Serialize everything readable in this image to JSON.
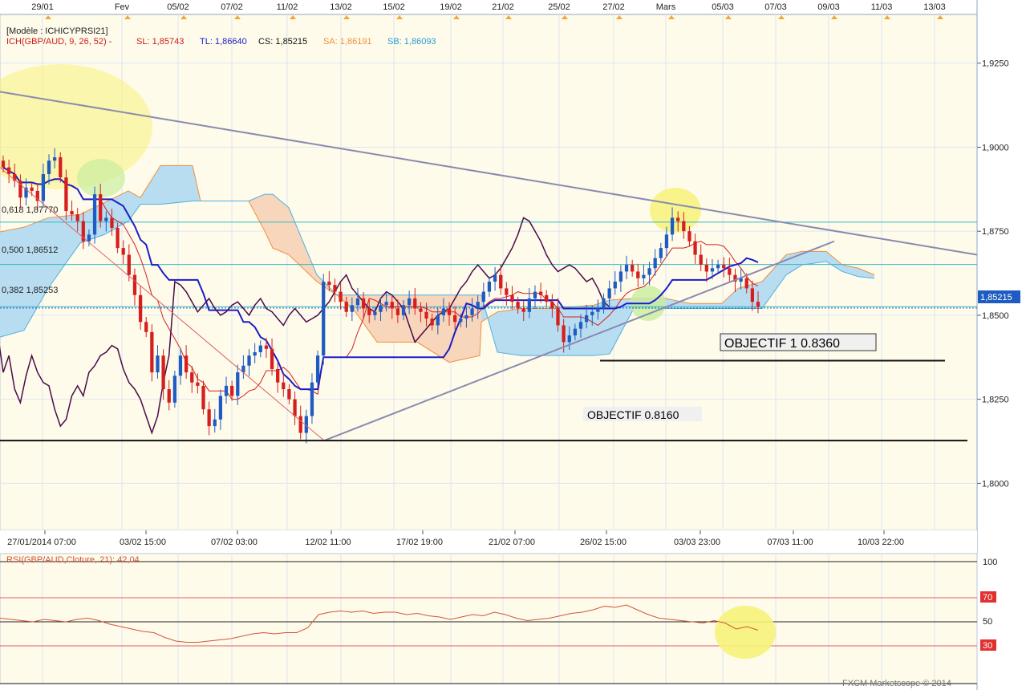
{
  "header": {
    "model": "[Modèle : ICHICYPRSI21]",
    "ichimoku_name": "ICH(GBP/AUD, 9, 26, 52) -",
    "sl": "SL: 1,85743",
    "tl": "TL: 1,86640",
    "cs": "CS: 1,85215",
    "sa": "SA: 1,86191",
    "sb": "SB: 1,86093"
  },
  "colors": {
    "background": "#FFFFFF",
    "price_panel": "#FEFBEA",
    "grid": "#DEE6F2",
    "top_axis": "#FFFFFF",
    "bull_candle": "#1F5CC2",
    "bear_candle": "#D71E1E",
    "tenkan": "#D71E1E",
    "kijun": "#1C1CC8",
    "chikou": "#4A0A4A",
    "senkou_a": "#F08E3C",
    "senkou_b": "#4EB0E0",
    "cloud_bull": "#B9DDF0",
    "cloud_bear": "#F7D6BB",
    "fib_line": "#39B7C4",
    "trendline": "#8A8AB0",
    "highlight_yellow": "#F7F27A",
    "highlight_green": "#C9EE9E",
    "current_price_tag": "#1F5CC2",
    "rsi_line": "#D2553A",
    "rsi_band": "#E06060",
    "rsi_tag": "#E03030"
  },
  "top_dates": [
    "29/01",
    "Fev",
    "05/02",
    "07/02",
    "11/02",
    "13/02",
    "15/02",
    "19/02",
    "21/02",
    "25/02",
    "27/02",
    "Mars",
    "05/03",
    "07/03",
    "09/03",
    "11/03",
    "13/03"
  ],
  "bottom_dates": [
    "27/01/2014 07:00",
    "03/02 15:00",
    "07/02 03:00",
    "12/02 11:00",
    "17/02 19:00",
    "21/02 07:00",
    "26/02 15:00",
    "03/03 23:00",
    "07/03 11:00",
    "10/03 22:00"
  ],
  "fib_labels": [
    "0,618 1,87770",
    "0,500 1,86512",
    "0,382 1,85253"
  ],
  "annotations": {
    "objectif1": "OBJECTIF 1 0.8360",
    "objectif2": "OBJECTIF 0.8160"
  },
  "current_price": "1,85215",
  "rsi": {
    "label": "RSI(GBP/AUD,Cloture, 21): 42,04",
    "levels": [
      "100",
      "70",
      "50",
      "30"
    ]
  },
  "footer": "FXCM Marketscope © 2014",
  "chart_data": {
    "type": "candlestick",
    "title": "",
    "instrument": "GBP/AUD",
    "y_axis": {
      "ticks": [
        "1,9250",
        "1,9000",
        "1,8750",
        "1,8500",
        "1,8250",
        "1,8000"
      ],
      "range": [
        1.786,
        1.9395
      ]
    },
    "fib_levels": [
      {
        "ratio": "0,618",
        "value": 1.8777
      },
      {
        "ratio": "0,500",
        "value": 1.86512
      },
      {
        "ratio": "0,382",
        "value": 1.85253
      }
    ],
    "horizontal_lines": [
      {
        "name": "OBJECTIF 1 0.8360",
        "value": 1.8365
      },
      {
        "name": "OBJECTIF 0.8160",
        "value": 1.8127
      }
    ],
    "ichimoku": {
      "tenkan": 1.85743,
      "kijun": 1.8664,
      "chikou": 1.85215,
      "senkou_a": 1.86191,
      "senkou_b": 1.86093
    },
    "close": [
      1.894,
      1.892,
      1.89,
      1.885,
      1.888,
      1.887,
      1.884,
      1.892,
      1.896,
      1.897,
      1.891,
      1.881,
      1.88,
      1.878,
      1.872,
      1.874,
      1.886,
      1.878,
      1.879,
      1.876,
      1.87,
      1.868,
      1.862,
      1.856,
      1.848,
      1.845,
      1.833,
      1.838,
      1.828,
      1.824,
      1.832,
      1.838,
      1.833,
      1.83,
      1.829,
      1.822,
      1.817,
      1.819,
      1.826,
      1.829,
      1.826,
      1.833,
      1.835,
      1.838,
      1.839,
      1.841,
      1.84,
      1.834,
      1.83,
      1.828,
      1.825,
      1.82,
      1.815,
      1.82,
      1.83,
      1.838,
      1.86,
      1.859,
      1.857,
      1.854,
      1.851,
      1.853,
      1.855,
      1.852,
      1.85,
      1.851,
      1.853,
      1.854,
      1.852,
      1.85,
      1.853,
      1.855,
      1.852,
      1.851,
      1.849,
      1.847,
      1.85,
      1.852,
      1.85,
      1.848,
      1.849,
      1.85,
      1.852,
      1.854,
      1.857,
      1.86,
      1.862,
      1.858,
      1.856,
      1.854,
      1.852,
      1.851,
      1.855,
      1.857,
      1.856,
      1.854,
      1.852,
      1.847,
      1.842,
      1.844,
      1.846,
      1.848,
      1.85,
      1.851,
      1.852,
      1.855,
      1.858,
      1.86,
      1.863,
      1.865,
      1.863,
      1.861,
      1.862,
      1.864,
      1.867,
      1.87,
      1.874,
      1.879,
      1.878,
      1.875,
      1.872,
      1.868,
      1.865,
      1.863,
      1.864,
      1.865,
      1.864,
      1.862,
      1.86,
      1.861,
      1.858,
      1.854,
      1.8525
    ],
    "rsi_values": [
      53,
      52,
      51,
      50,
      52,
      51,
      50,
      52,
      53,
      51,
      48,
      46,
      44,
      42,
      41,
      37,
      34,
      33,
      33,
      34,
      35,
      36,
      38,
      40,
      41,
      40,
      41,
      41,
      45,
      56,
      58,
      59,
      58,
      59,
      57,
      58,
      58,
      56,
      57,
      55,
      54,
      52,
      54,
      56,
      55,
      58,
      56,
      53,
      51,
      52,
      53,
      55,
      57,
      58,
      60,
      63,
      62,
      64,
      60,
      56,
      53,
      52,
      51,
      50,
      49,
      51,
      49,
      44,
      46,
      43
    ],
    "rsi_range": [
      0,
      100
    ]
  }
}
